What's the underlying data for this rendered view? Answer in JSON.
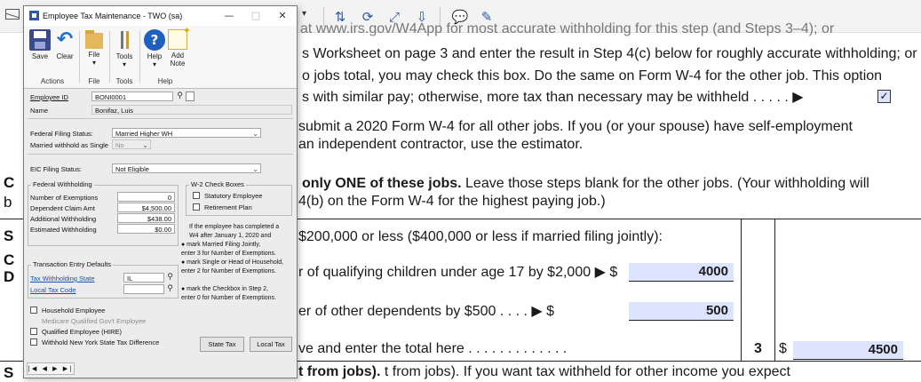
{
  "pdf": {
    "lines": [
      "at www.irs.gov/W4App for most accurate withholding for this step (and Steps 3–4); or",
      "s Worksheet on page 3 and enter the result in Step 4(c) below for roughly accurate withholding; or",
      "o jobs total, you may check this box. Do the same on Form W-4 for the other job. This option",
      "s with similar pay; otherwise, more tax than necessary may be withheld  .  .  .  .  .  ▶",
      "submit a 2020 Form W-4 for all other jobs. If you (or your spouse) have self-employment",
      "an independent contractor, use the estimator.",
      "Leave those steps blank for the other jobs. (Your withholding will",
      "4(b) on the Form W-4 for the highest paying job.)",
      "$200,000 or less ($400,000 or less if married filing jointly):",
      "r of qualifying children under age 17 by $2,000 ▶  $",
      "er of other dependents by $500   .  .  .  .  ▶  $",
      "ve and enter the total here  .  .  .  .  .  .  .  .  .  .  .  .  .",
      "t from jobs). If you want tax withheld for other income you expect"
    ],
    "bold_phrase": "only ONE of these jobs.",
    "bold_last": "t from jobs).",
    "step_letters": [
      "C",
      "b",
      "S",
      "C",
      "D",
      "S"
    ],
    "checkbox_mark": "✓",
    "amounts": {
      "children": "4000",
      "dependents": "500",
      "total_line": "3",
      "total_dollar": "$",
      "total": "4500"
    }
  },
  "dialog": {
    "title": "Employee Tax Maintenance  -  TWO (sa)",
    "controls": {
      "minimize": "—",
      "restore": "□",
      "close": "✕"
    },
    "ribbon": {
      "save": "Save",
      "clear": "Clear",
      "file": "File",
      "tools": "Tools",
      "help": "Help",
      "add_note_1": "Add",
      "add_note_2": "Note",
      "groups": {
        "actions": "Actions",
        "file": "File",
        "tools": "Tools",
        "help": "Help"
      }
    },
    "employee_id_label": "Employee ID",
    "employee_id": "BONI0001",
    "name_label": "Name",
    "name": "Bonifaz, Luis",
    "federal_filing_status_label": "Federal Filing Status:",
    "federal_filing_status": "Married Higher WH",
    "married_single_label": "Married withhold as Single",
    "married_single": "No",
    "eic_label": "EIC Filing Status:",
    "eic_status": "Not Eligible",
    "federal_withholding": {
      "title": "Federal Withholding",
      "rows": [
        {
          "label": "Number of Exemptions",
          "value": "0"
        },
        {
          "label": "Dependent Claim Amt",
          "value": "$4,500.00"
        },
        {
          "label": "Additional Withholding",
          "value": "$438.00"
        },
        {
          "label": "Estimated Withholding",
          "value": "$0.00"
        }
      ]
    },
    "w2": {
      "title": "W-2 Check Boxes",
      "statutory": "Statutory Employee",
      "retirement": "Retirement Plan"
    },
    "note_lines": [
      "If the employee has completed a",
      "W4 after January 1, 2020 and",
      "● mark Married Filing Jointly,",
      "   enter 3 for Number of Exemptions.",
      "● mark Single or Head of Household,",
      "   enter 2 for Number of Exemptions.",
      "● mark the Checkbox in Step 2,",
      "   enter 0 for Number of Exemptions."
    ],
    "transaction": {
      "title": "Transaction Entry Defaults",
      "tax_withholding_state_label": "Tax Withholding State",
      "tax_withholding_state": "IL",
      "local_tax_code_label": "Local Tax Code",
      "local_tax_code": ""
    },
    "checkboxes": {
      "household": "Household Employee",
      "medicare": "Medicare Qualified Gov't Employee",
      "hire": "Qualified Employee (HIRE)",
      "ny": "Withhold New York State Tax Difference"
    },
    "buttons": {
      "state_tax": "State Tax",
      "local_tax": "Local Tax"
    },
    "nav": "|◀ ◀ ▶ ▶|"
  }
}
